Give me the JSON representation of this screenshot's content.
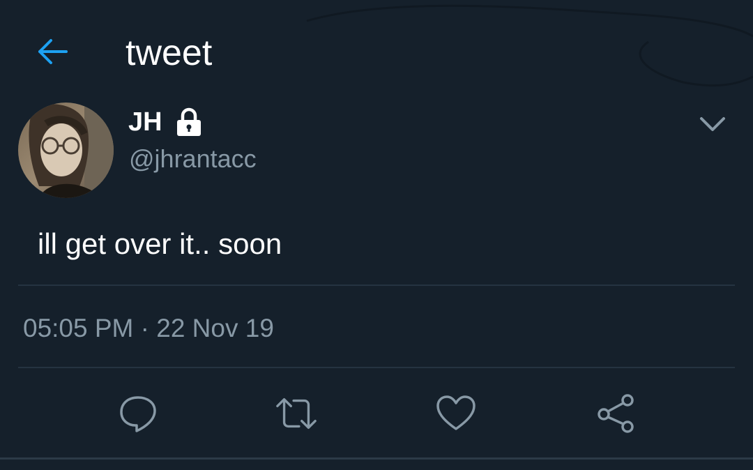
{
  "header": {
    "title": "tweet",
    "back_icon": "arrow-left-icon",
    "accent_color": "#1da1f2"
  },
  "tweet": {
    "display_name": "JH",
    "protected_icon": "lock-icon",
    "handle": "@jhrantacc",
    "text": "ill get over it.. soon",
    "timestamp": "05:05 PM · 22 Nov 19",
    "menu_icon": "chevron-down-icon"
  },
  "actions": [
    {
      "name": "reply",
      "icon": "reply-icon"
    },
    {
      "name": "retweet",
      "icon": "retweet-icon"
    },
    {
      "name": "like",
      "icon": "heart-icon"
    },
    {
      "name": "share",
      "icon": "share-icon"
    }
  ],
  "colors": {
    "background": "#15202b",
    "primary_text": "#ffffff",
    "secondary_text": "#8899a6",
    "divider": "#253341"
  }
}
